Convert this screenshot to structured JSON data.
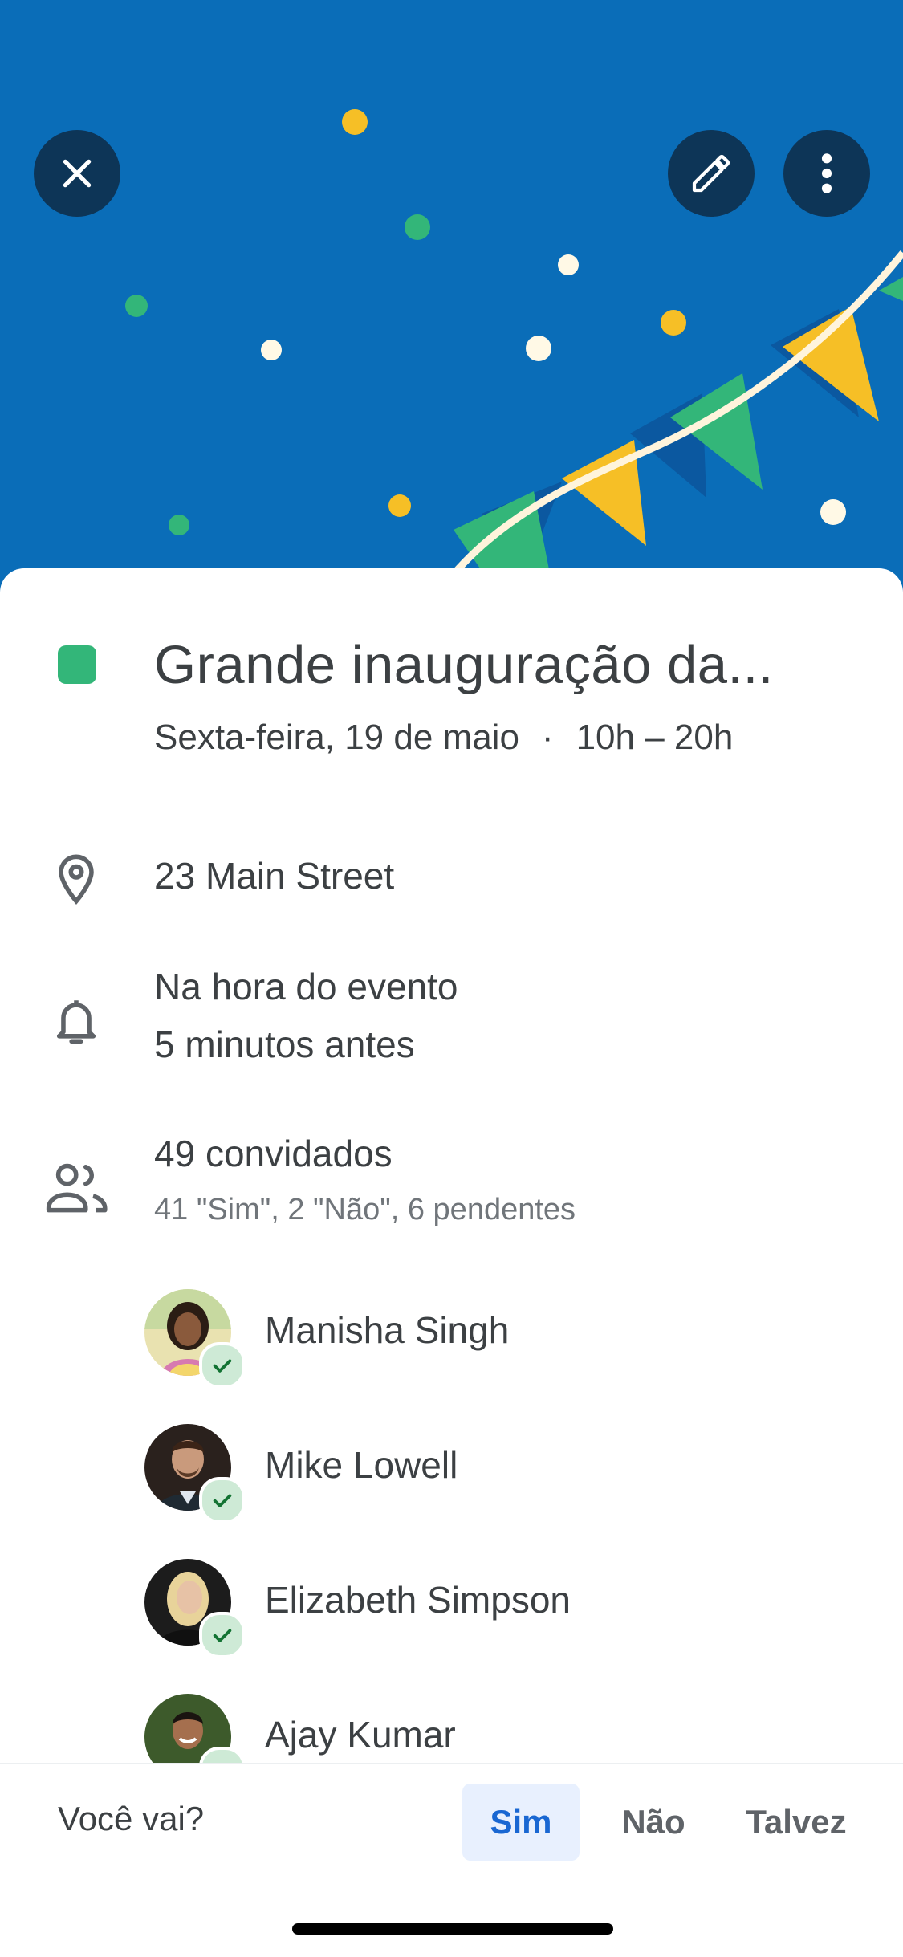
{
  "event": {
    "title": "Grande inauguração da...",
    "date": "Sexta-feira, 19 de maio",
    "separator": "·",
    "time": "10h – 20h",
    "color": "#33b679"
  },
  "header": {
    "close_icon": "close-icon",
    "edit_icon": "pencil-icon",
    "more_icon": "more-vert-icon",
    "background_color": "#0a6db8"
  },
  "location": {
    "text": "23 Main Street"
  },
  "notifications": {
    "first": "Na hora do evento",
    "second": "5 minutos antes"
  },
  "guests": {
    "count_label": "49 convidados",
    "summary": "41 \"Sim\", 2 \"Não\", 6 pendentes",
    "list": [
      {
        "name": "Manisha Singh"
      },
      {
        "name": "Mike Lowell"
      },
      {
        "name": "Elizabeth Simpson"
      },
      {
        "name": "Ajay Kumar"
      }
    ]
  },
  "rsvp": {
    "question": "Você vai?",
    "options": [
      "Sim",
      "Não",
      "Talvez"
    ],
    "selected": "Sim"
  }
}
